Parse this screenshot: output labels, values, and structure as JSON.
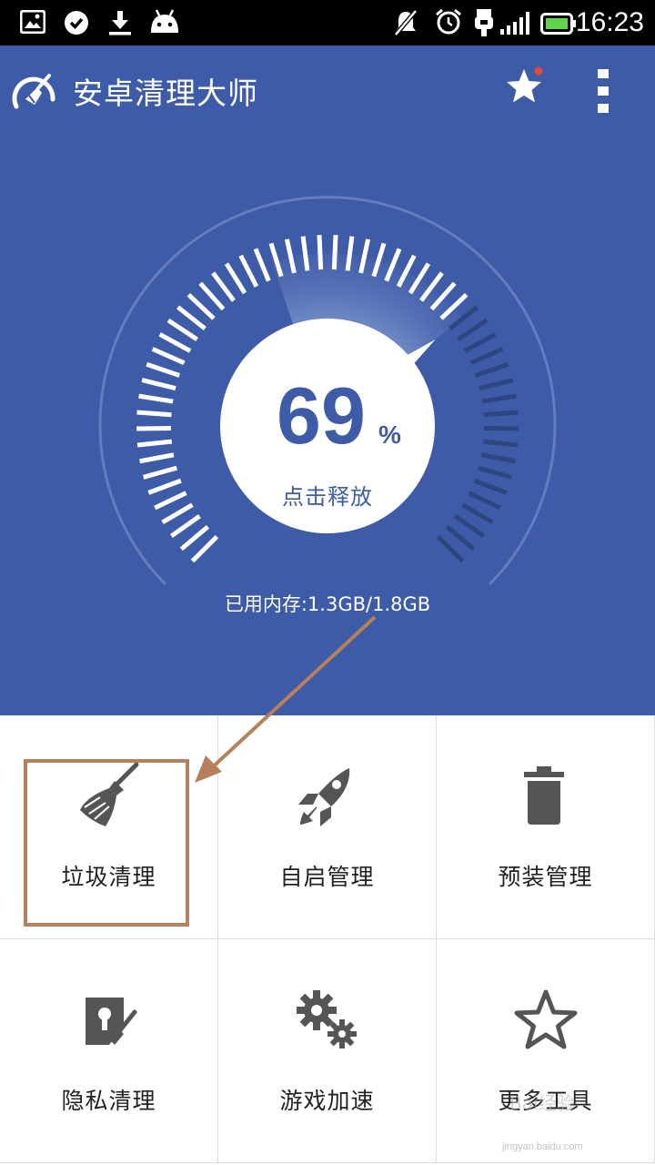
{
  "status_bar": {
    "time": "16:23",
    "left_icons": [
      "image-icon",
      "check-circle-icon",
      "download-icon",
      "android-icon"
    ],
    "right_icons": [
      "notifications-off-icon",
      "alarm-icon",
      "usb-icon",
      "signal-icon",
      "battery-icon"
    ]
  },
  "app_bar": {
    "title": "安卓清理大师",
    "logo_icon": "broom-gauge-logo-icon",
    "star_icon": "star-icon",
    "menu_icon": "more-vert-icon"
  },
  "gauge": {
    "percent_value": "69",
    "percent_unit": "%",
    "release_label": "点击释放",
    "memory_usage": "已用内存:1.3GB/1.8GB",
    "level": 0.69
  },
  "tiles": [
    {
      "label": "垃圾清理",
      "icon": "broom-icon"
    },
    {
      "label": "自启管理",
      "icon": "rocket-icon"
    },
    {
      "label": "预装管理",
      "icon": "trash-icon"
    },
    {
      "label": "隐私清理",
      "icon": "privacy-lock-icon"
    },
    {
      "label": "游戏加速",
      "icon": "gears-icon"
    },
    {
      "label": "更多工具",
      "icon": "star-outline-icon"
    }
  ],
  "watermark": {
    "text": "Bai经验",
    "sub": "jingyan.baidu.com"
  },
  "colors": {
    "primary": "#3e5ba8",
    "tile_icon": "#555555",
    "annotation": "#b5805c"
  }
}
